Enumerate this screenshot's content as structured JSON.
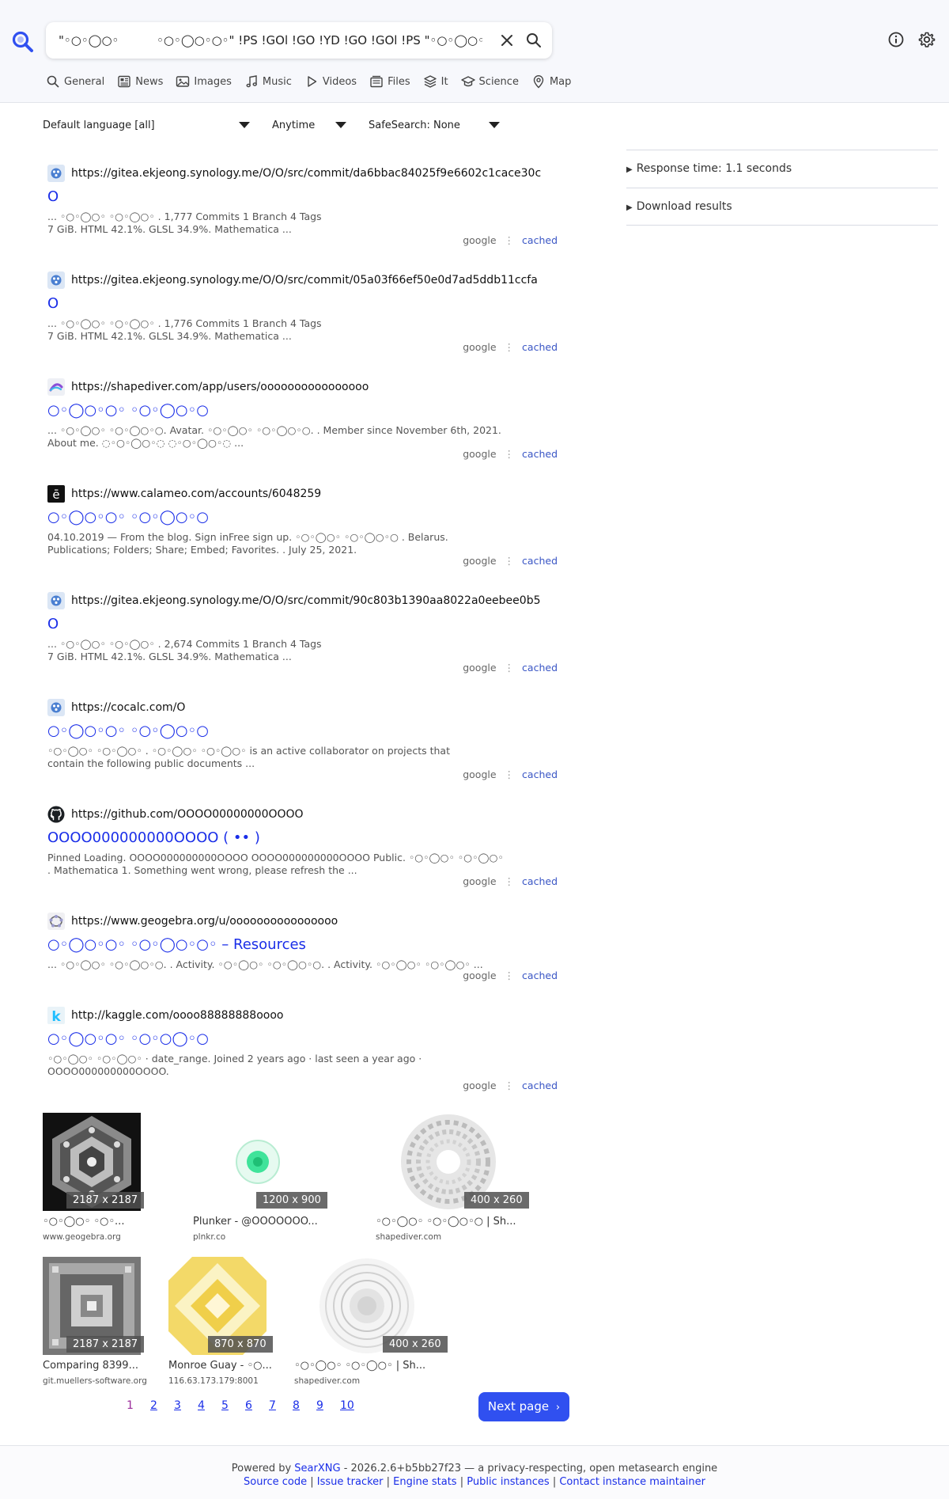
{
  "search": {
    "query": "\"◦○◦◯○◦          ◦○◦◯○◦○◦\" !PS !GOl !GO !YD !GO !GOl !PS \"◦○◦◯○◦"
  },
  "tabs": [
    {
      "label": "General",
      "icon": "search-icon"
    },
    {
      "label": "News",
      "icon": "newspaper-icon"
    },
    {
      "label": "Images",
      "icon": "image-icon"
    },
    {
      "label": "Music",
      "icon": "music-icon"
    },
    {
      "label": "Videos",
      "icon": "play-icon"
    },
    {
      "label": "Files",
      "icon": "files-icon"
    },
    {
      "label": "It",
      "icon": "layers-icon"
    },
    {
      "label": "Science",
      "icon": "graduation-cap-icon"
    },
    {
      "label": "Map",
      "icon": "map-pin-icon"
    }
  ],
  "filters": {
    "language": "Default language [all]",
    "time": "Anytime",
    "safesearch": "SafeSearch: None"
  },
  "sidebar": {
    "response_time": "Response time: 1.1 seconds",
    "download": "Download results"
  },
  "results": [
    {
      "url": "https://gitea.ekjeong.synology.me/O/O/src/commit/da6bbac84025f9e6602c1cace30c",
      "title": "O",
      "content": "... ◦○◦◯○◦      ◦○◦◯○◦                                                                         . 1,777 Commits 1 Branch 4 Tags\n7 GiB. HTML 42.1%. GLSL 34.9%. Mathematica ...",
      "engine": "google",
      "cached": "cached",
      "favicon": "gitea"
    },
    {
      "url": "https://gitea.ekjeong.synology.me/O/O/src/commit/05a03f66ef50e0d7ad5ddb11ccfa",
      "title": "O",
      "content": "... ◦○◦◯○◦      ◦○◦◯○◦                                                                         . 1,776 Commits 1 Branch 4 Tags\n7 GiB. HTML 42.1%. GLSL 34.9%. Mathematica ...",
      "engine": "google",
      "cached": "cached",
      "favicon": "gitea"
    },
    {
      "url": "https://shapediver.com/app/users/oooooooooooooooo",
      "title": "○◦◯○◦○◦        ◦○◦◯○◦○",
      "content": "... ◦○◦◯○◦      ◦○◦◯○◦○. Avatar. ◦○◦◯○◦      ◦○◦◯○◦○. . Member since November 6th, 2021.\nAbout me. ◌◦○◦◯○◦◌     ◌◦○◦◯○◦◌ ...",
      "engine": "google",
      "cached": "cached",
      "favicon": "shapediver"
    },
    {
      "url": "https://www.calameo.com/accounts/6048259",
      "title": "○◦◯○◦○◦        ◦○◦◯○◦○",
      "content": "04.10.2019 — From the blog. Sign inFree sign up.       ◦○◦◯○◦      ◦○◦◯○◦○       . Belarus.\nPublications; Folders; Share; Embed; Favorites.    . July 25, 2021.",
      "engine": "google",
      "cached": "cached",
      "favicon": "calameo"
    },
    {
      "url": "https://gitea.ekjeong.synology.me/O/O/src/commit/90c803b1390aa8022a0eebee0b5",
      "title": "O",
      "content": "... ◦○◦◯○◦      ◦○◦◯○◦                                                                         . 2,674 Commits 1 Branch 4 Tags\n7 GiB. HTML 42.1%. GLSL 34.9%. Mathematica ...",
      "engine": "google",
      "cached": "cached",
      "favicon": "gitea"
    },
    {
      "url": "https://cocalc.com/O",
      "title": "○◦◯○◦○◦        ◦○◦◯○◦○",
      "content": "◦○◦◯○◦      ◦○◦◯○◦    . ◦○◦◯○◦      ◦○◦◯○◦      is an active collaborator on projects that\ncontain the following public documents ...",
      "engine": "google",
      "cached": "cached",
      "favicon": "gitea"
    },
    {
      "url": "https://github.com/OOOO00000000OOOO",
      "title": "OOOO000000000OOOO (                 ••                 )",
      "content": "Pinned Loading. OOOO000000000OOOO OOOO000000000OOOO Public.       ◦○◦◯○◦      ◦○◦◯○◦\n      . Mathematica 1. Something went wrong, please refresh the ...",
      "engine": "google",
      "cached": "cached",
      "favicon": "github"
    },
    {
      "url": "https://www.geogebra.org/u/oooooooooooooooo",
      "title": "○◦◯○◦○◦        ◦○◦◯○◦○◦ – Resources",
      "content": "... ◦○◦◯○◦      ◦○◦◯○◦○.    . Activity. ◦○◦◯○◦      ◦○◦◯○◦○.    . Activity. ◦○◦◯○◦      ◦○◦◯○◦ ...",
      "engine": "google",
      "cached": "cached",
      "favicon": "geogebra"
    },
    {
      "url": "http://kaggle.com/oooo88888888oooo",
      "title": "○◦◯○◦○◦        ◦○◦○◯◦○",
      "content": "◦○◦◯○◦      ◦○◦◯○◦ · date_range. Joined 2 years ago · last seen a year ago ·\nOOOO000000000OOOO.",
      "engine": "google",
      "cached": "cached",
      "favicon": "kaggle"
    }
  ],
  "images": [
    {
      "title": "◦○◦◯○◦      ◦○◦...",
      "host": "www.geogebra.org",
      "resolution": "2187 x 2187",
      "art": "hex-fractal"
    },
    {
      "title": "Plunker - @OOOOOOO...",
      "host": "plnkr.co",
      "resolution": "1200 x 900",
      "art": "green-orb"
    },
    {
      "title": "◦○◦◯○◦      ◦○◦◯○◦○ | Sh...",
      "host": "shapediver.com",
      "resolution": "400 x 260",
      "art": "swirl-disc"
    },
    {
      "title": "Comparing 8399...",
      "host": "git.muellers-software.org",
      "resolution": "2187 x 2187",
      "art": "square-fractal"
    },
    {
      "title": "Monroe Guay - ◦○...",
      "host": "116.63.173.179:8001",
      "resolution": "870 x 870",
      "art": "yellow-quilt"
    },
    {
      "title": "◦○◦◯○◦      ◦○◦◯○◦ | Sh...",
      "host": "shapediver.com",
      "resolution": "400 x 260",
      "art": "ring-disc"
    }
  ],
  "pagination": {
    "current": "1",
    "pages": [
      "2",
      "3",
      "4",
      "5",
      "6",
      "7",
      "8",
      "9",
      "10"
    ],
    "next_label": "Next page"
  },
  "footer": {
    "powered_prefix": "Powered by",
    "searxng": "SearXNG",
    "powered_suffix": "- 2026.2.6+b5bb27f23 — a privacy-respecting, open metasearch engine",
    "links": [
      "Source code",
      "Issue tracker",
      "Engine stats",
      "Public instances",
      "Contact instance maintainer"
    ]
  },
  "colors": {
    "accent": "#3050f0",
    "link": "#1a2ee8",
    "cached": "#3a56c5",
    "header_bg": "#f7f8fc"
  }
}
